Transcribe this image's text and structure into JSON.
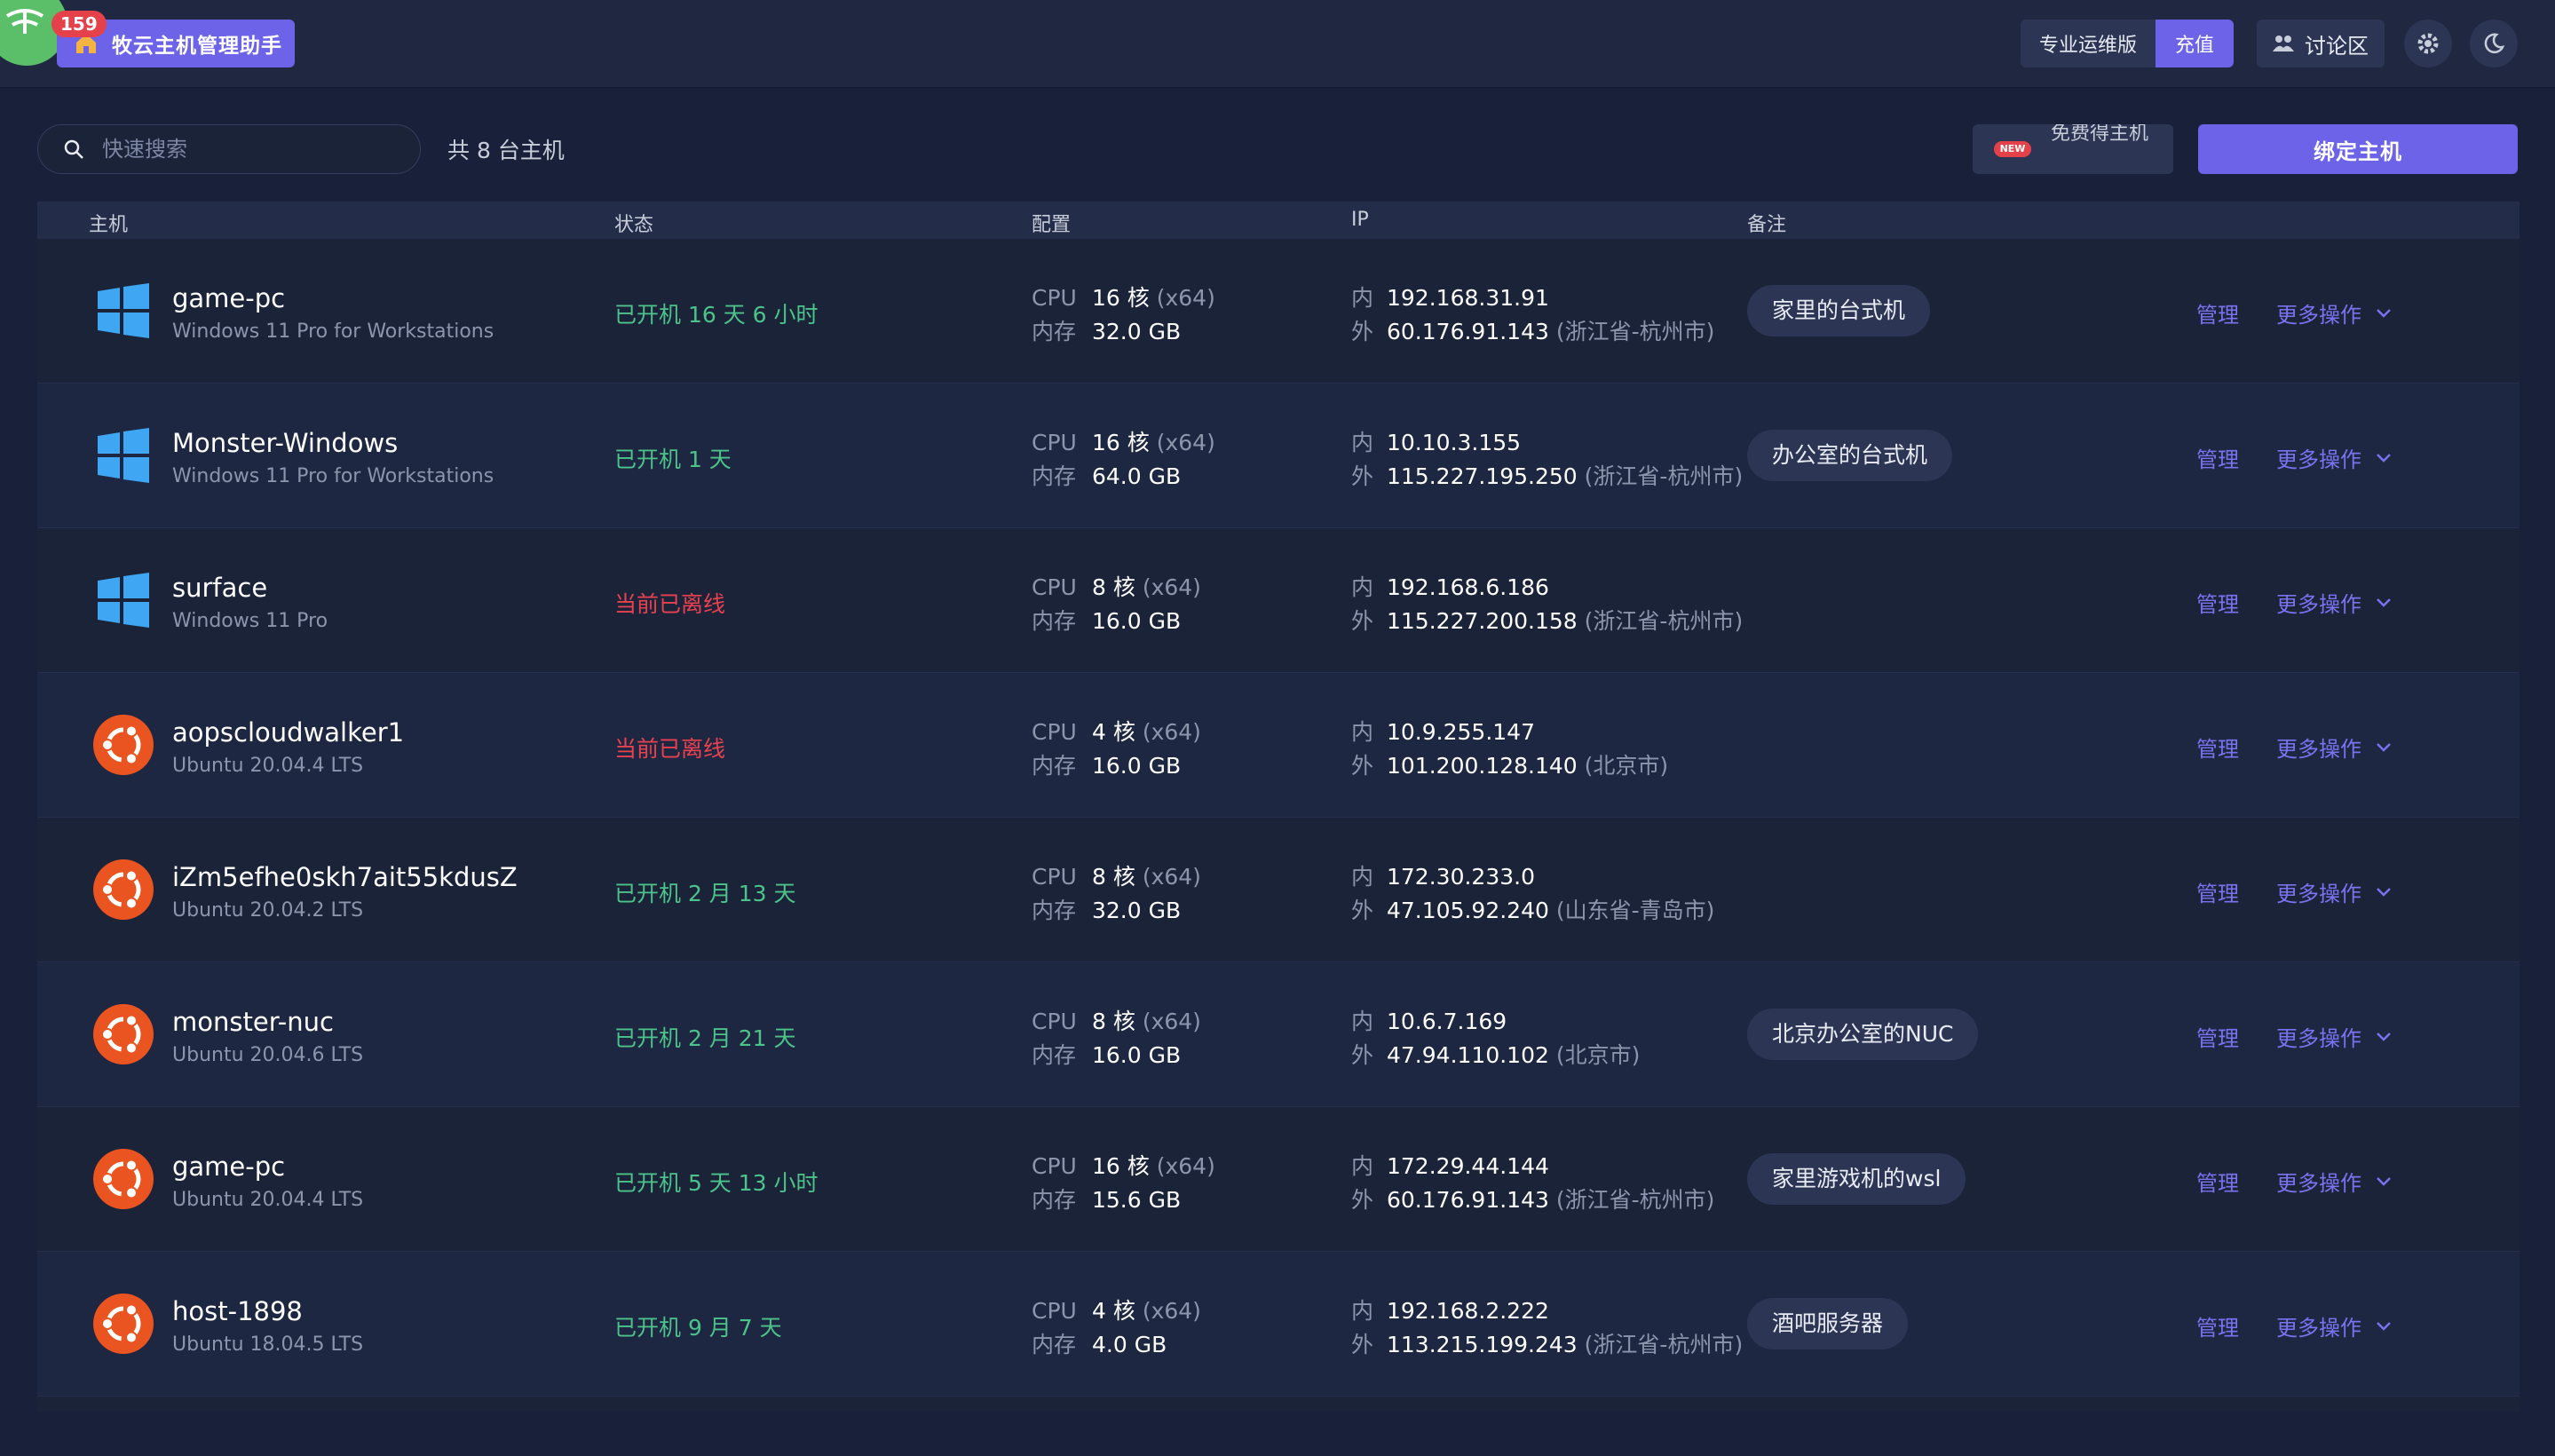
{
  "header": {
    "notification_count": "159",
    "app_title": "牧云主机管理助手",
    "plan_label": "专业运维版",
    "recharge_label": "充值",
    "forum_label": "讨论区"
  },
  "toolbar": {
    "search_placeholder": "快速搜索",
    "host_count": "共 8 台主机",
    "new_badge": "NEW",
    "free_host_label": "免费得主机",
    "bind_label": "绑定主机"
  },
  "table": {
    "columns": {
      "host": "主机",
      "status": "状态",
      "config": "配置",
      "ip": "IP",
      "note": "备注"
    },
    "cpu_label": "CPU",
    "mem_label": "内存",
    "inner_label": "内",
    "outer_label": "外",
    "manage_label": "管理",
    "more_label": "更多操作",
    "rows": [
      {
        "os": "windows",
        "name": "game-pc",
        "os_name": "Windows 11 Pro for Workstations",
        "status": "已开机 16 天 6 小时",
        "online": true,
        "cpu": "16 核",
        "arch": "(x64)",
        "mem": "32.0 GB",
        "ip_in": "192.168.31.91",
        "ip_out": "60.176.91.143",
        "region": "(浙江省-杭州市)",
        "note": "家里的台式机"
      },
      {
        "os": "windows",
        "name": "Monster-Windows",
        "os_name": "Windows 11 Pro for Workstations",
        "status": "已开机 1 天",
        "online": true,
        "cpu": "16 核",
        "arch": "(x64)",
        "mem": "64.0 GB",
        "ip_in": "10.10.3.155",
        "ip_out": "115.227.195.250",
        "region": "(浙江省-杭州市)",
        "note": "办公室的台式机"
      },
      {
        "os": "windows",
        "name": "surface",
        "os_name": "Windows 11 Pro",
        "status": "当前已离线",
        "online": false,
        "cpu": "8 核",
        "arch": "(x64)",
        "mem": "16.0 GB",
        "ip_in": "192.168.6.186",
        "ip_out": "115.227.200.158",
        "region": "(浙江省-杭州市)",
        "note": ""
      },
      {
        "os": "ubuntu",
        "name": "aopscloudwalker1",
        "os_name": "Ubuntu 20.04.4 LTS",
        "status": "当前已离线",
        "online": false,
        "cpu": "4 核",
        "arch": "(x64)",
        "mem": "16.0 GB",
        "ip_in": "10.9.255.147",
        "ip_out": "101.200.128.140",
        "region": "(北京市)",
        "note": ""
      },
      {
        "os": "ubuntu",
        "name": "iZm5efhe0skh7ait55kdusZ",
        "os_name": "Ubuntu 20.04.2 LTS",
        "status": "已开机 2 月 13 天",
        "online": true,
        "cpu": "8 核",
        "arch": "(x64)",
        "mem": "32.0 GB",
        "ip_in": "172.30.233.0",
        "ip_out": "47.105.92.240",
        "region": "(山东省-青岛市)",
        "note": ""
      },
      {
        "os": "ubuntu",
        "name": "monster-nuc",
        "os_name": "Ubuntu 20.04.6 LTS",
        "status": "已开机 2 月 21 天",
        "online": true,
        "cpu": "8 核",
        "arch": "(x64)",
        "mem": "16.0 GB",
        "ip_in": "10.6.7.169",
        "ip_out": "47.94.110.102",
        "region": "(北京市)",
        "note": "北京办公室的NUC"
      },
      {
        "os": "ubuntu",
        "name": "game-pc",
        "os_name": "Ubuntu 20.04.4 LTS",
        "status": "已开机 5 天 13 小时",
        "online": true,
        "cpu": "16 核",
        "arch": "(x64)",
        "mem": "15.6 GB",
        "ip_in": "172.29.44.144",
        "ip_out": "60.176.91.143",
        "region": "(浙江省-杭州市)",
        "note": "家里游戏机的wsl"
      },
      {
        "os": "ubuntu",
        "name": "host-1898",
        "os_name": "Ubuntu 18.04.5 LTS",
        "status": "已开机 9 月 7 天",
        "online": true,
        "cpu": "4 核",
        "arch": "(x64)",
        "mem": "4.0 GB",
        "ip_in": "192.168.2.222",
        "ip_out": "113.215.199.243",
        "region": "(浙江省-杭州市)",
        "note": "酒吧服务器"
      }
    ]
  }
}
